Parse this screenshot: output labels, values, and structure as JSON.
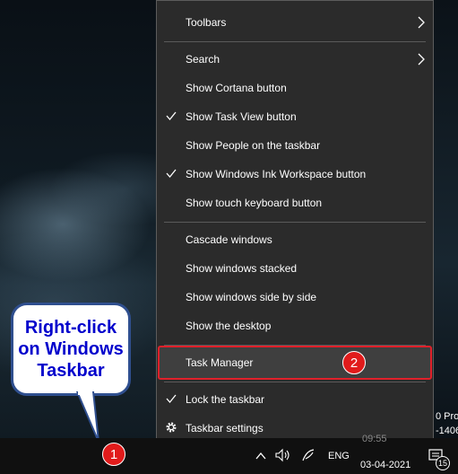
{
  "menu": {
    "items": [
      {
        "label": "Toolbars",
        "submenu": true,
        "checked": false
      },
      {
        "label": "Search",
        "submenu": true,
        "checked": false
      },
      {
        "label": "Show Cortana button",
        "checked": false
      },
      {
        "label": "Show Task View button",
        "checked": true
      },
      {
        "label": "Show People on the taskbar",
        "checked": false
      },
      {
        "label": "Show Windows Ink Workspace button",
        "checked": true
      },
      {
        "label": "Show touch keyboard button",
        "checked": false
      },
      {
        "label": "Cascade windows",
        "checked": false
      },
      {
        "label": "Show windows stacked",
        "checked": false
      },
      {
        "label": "Show windows side by side",
        "checked": false
      },
      {
        "label": "Show the desktop",
        "checked": false
      },
      {
        "label": "Task Manager",
        "checked": false
      },
      {
        "label": "Lock the taskbar",
        "checked": true
      },
      {
        "label": "Taskbar settings",
        "icon": "gear-icon"
      }
    ]
  },
  "callout": {
    "lines": [
      "Right-click",
      "on Windows",
      "Taskbar"
    ]
  },
  "badges": {
    "one": "1",
    "two": "2"
  },
  "tray": {
    "language": "ENG",
    "time": "09:55",
    "date": "03-04-2021",
    "notification_count": "15"
  },
  "side_text": {
    "line1": "0 Pro",
    "line2": "-1406"
  },
  "colors": {
    "menu_bg": "#2b2b2b",
    "highlight_border": "#e0202a",
    "badge": "#e11b1b",
    "callout_text": "#0000cc",
    "callout_border": "#2f4f8f"
  }
}
